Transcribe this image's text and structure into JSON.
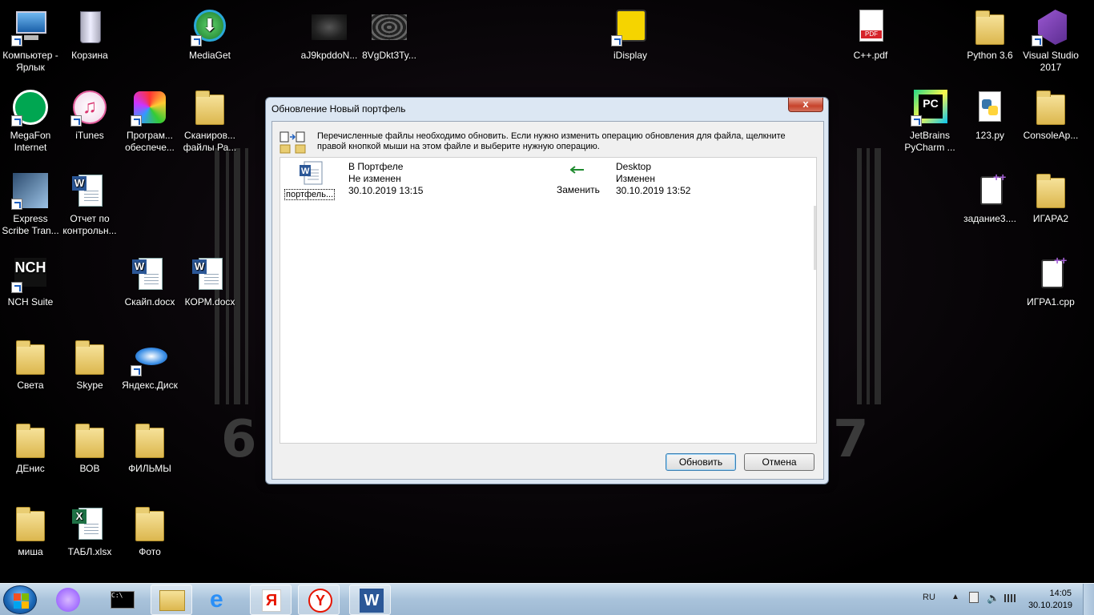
{
  "desktop": {
    "icons": [
      {
        "id": "computer",
        "label": "Компьютер - Ярлык"
      },
      {
        "id": "recycle",
        "label": "Корзина"
      },
      {
        "id": "mediaget",
        "label": "MediaGet"
      },
      {
        "id": "img1",
        "label": "aJ9kpddoN..."
      },
      {
        "id": "img2",
        "label": "8VgDkt3Ty..."
      },
      {
        "id": "idisplay",
        "label": "iDisplay"
      },
      {
        "id": "cpppdf",
        "label": "C++.pdf"
      },
      {
        "id": "python",
        "label": "Python 3.6"
      },
      {
        "id": "vs",
        "label": "Visual Studio 2017"
      },
      {
        "id": "megafon",
        "label": "MegaFon Internet"
      },
      {
        "id": "itunes",
        "label": "iTunes"
      },
      {
        "id": "software",
        "label": "Програм... обеспече..."
      },
      {
        "id": "scans",
        "label": "Сканиров... файлы Ра..."
      },
      {
        "id": "pycharm",
        "label": "JetBrains PyCharm ..."
      },
      {
        "id": "py123",
        "label": "123.py"
      },
      {
        "id": "consoleapp",
        "label": "ConsoleAp..."
      },
      {
        "id": "express",
        "label": "Express Scribe Tran..."
      },
      {
        "id": "report",
        "label": "Отчет по контрольн..."
      },
      {
        "id": "task3",
        "label": "задание3...."
      },
      {
        "id": "igara2",
        "label": "ИГАРА2"
      },
      {
        "id": "nch",
        "label": "NCH Suite"
      },
      {
        "id": "skype_docx",
        "label": "Скайп.docx"
      },
      {
        "id": "korm",
        "label": "КОРМ.docx"
      },
      {
        "id": "igra1",
        "label": "ИГРА1.cpp"
      },
      {
        "id": "sveta",
        "label": "Света"
      },
      {
        "id": "skype_folder",
        "label": "Skype"
      },
      {
        "id": "yadisk",
        "label": "Яндекс.Диск"
      },
      {
        "id": "denis",
        "label": "ДЕнис"
      },
      {
        "id": "vov",
        "label": "ВОВ"
      },
      {
        "id": "films",
        "label": "ФИЛЬМЫ"
      },
      {
        "id": "misha",
        "label": "миша"
      },
      {
        "id": "tabl",
        "label": "ТАБЛ.xlsx"
      },
      {
        "id": "foto",
        "label": "Фото"
      }
    ],
    "wallpaper_numbers": [
      "6",
      "7"
    ]
  },
  "dialog": {
    "title": "Обновление Новый портфель",
    "close_glyph": "x",
    "message": "Перечисленные файлы необходимо обновить. Если  нужно изменить операцию обновления для файла, щелкните правой кнопкой мыши на этом файле и выберите нужную операцию.",
    "file": {
      "name": "портфель...",
      "left": {
        "location": "В Портфеле",
        "status": "Не изменен",
        "date": "30.10.2019 13:15"
      },
      "action": "Заменить",
      "right": {
        "location": "Desktop",
        "status": "Изменен",
        "date": "30.10.2019 13:52"
      }
    },
    "buttons": {
      "update": "Обновить",
      "cancel": "Отмена"
    }
  },
  "taskbar": {
    "pinned": [
      "start-button",
      "alice",
      "cmd",
      "explorer",
      "ie",
      "yandex-y",
      "yandex-browser",
      "word"
    ],
    "tray": {
      "language": "RU",
      "time": "14:05",
      "date": "30.10.2019"
    }
  },
  "colors": {
    "accent": "#1d5fbf",
    "dialog_bg": "#f0f0f0",
    "close_red": "#c7432b"
  }
}
